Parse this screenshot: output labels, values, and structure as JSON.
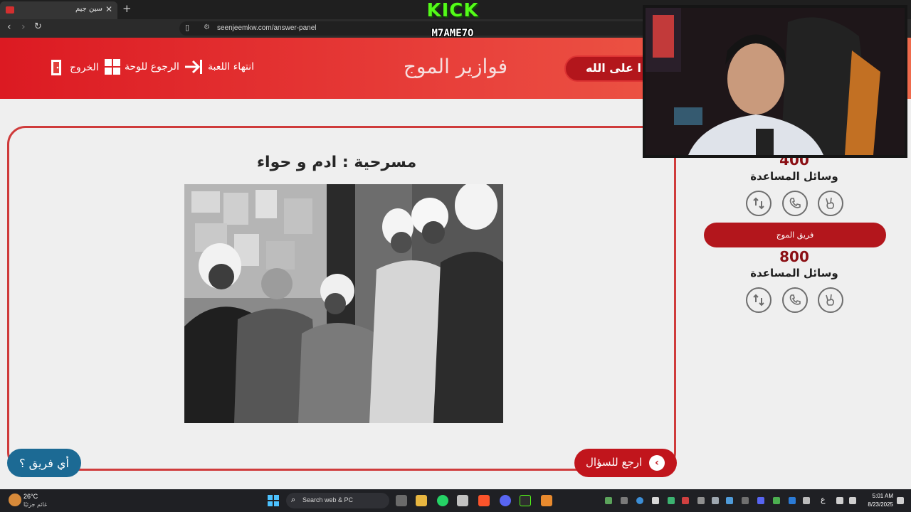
{
  "browser": {
    "tab_title": "سين جيم",
    "url": "seenjeemkw.com/answer-panel"
  },
  "overlay": {
    "logo_text": "KICK",
    "streamer_name": "M7AME7O"
  },
  "header": {
    "exit_label": "الخروج",
    "board_label": "الرجوع للوحة",
    "end_game_label": "انتهاء اللعبة",
    "title": "فوازير الموج",
    "turn_label": "ا على الله"
  },
  "question": {
    "title": "مسرحية : ادم و حواء"
  },
  "buttons": {
    "which_team": "أي فريق ؟",
    "back_to_question": "ارجع للسؤال"
  },
  "teams": [
    {
      "name": "",
      "score": "400",
      "help_label": "وسائل المساعدة"
    },
    {
      "name": "فريق الموج",
      "score": "800",
      "help_label": "وسائل المساعدة"
    }
  ],
  "taskbar": {
    "temperature": "26°C",
    "weather_desc": "غائم جزئيًا",
    "search_placeholder": "Search web & PC",
    "lang": "ع",
    "time": "5:01 AM",
    "date": "8/23/2025"
  }
}
